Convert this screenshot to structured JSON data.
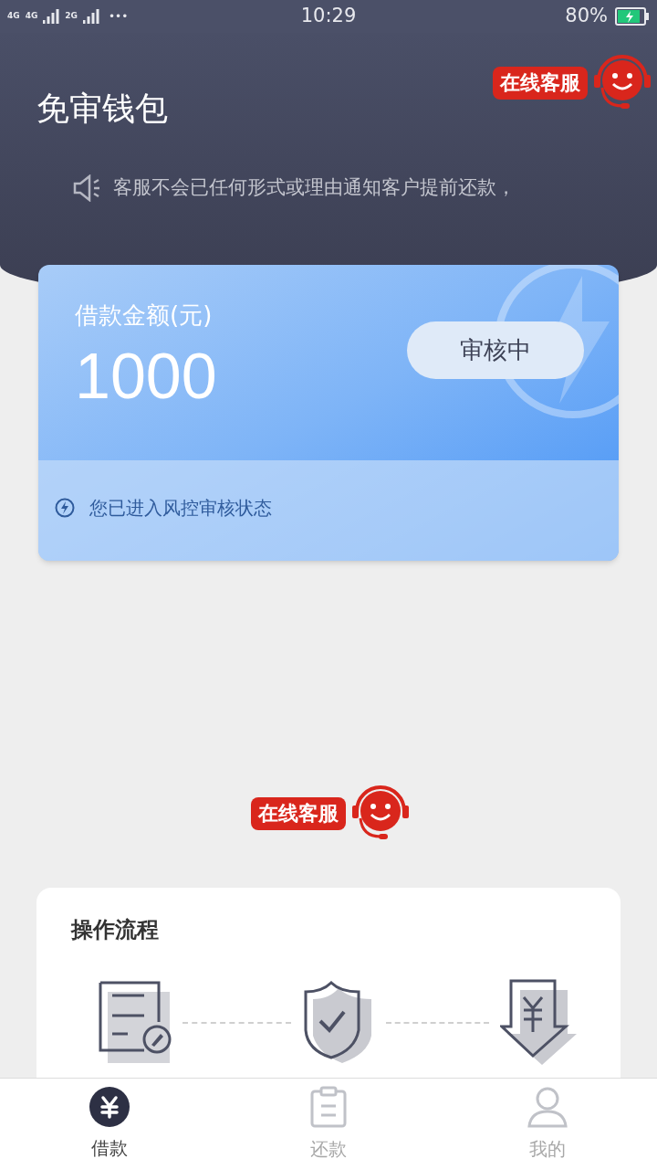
{
  "status_bar": {
    "network_1": "4G",
    "network_2": "4G",
    "network_3": "2G",
    "more": "•••",
    "time": "10:29",
    "battery": "80%"
  },
  "header": {
    "title": "免审钱包",
    "service_badge": "在线客服",
    "notice": "客服不会已任何形式或理由通知客户提前还款，"
  },
  "loan_card": {
    "label": "借款金额(元)",
    "amount": "1000",
    "status": "审核中",
    "hint": "您已进入风控审核状态"
  },
  "service_badge": "在线客服",
  "process": {
    "title": "操作流程",
    "steps": [
      {
        "kind": "form"
      },
      {
        "kind": "shield"
      },
      {
        "kind": "download"
      }
    ]
  },
  "tabs": [
    {
      "label": "借款",
      "kind": "loan",
      "selected": true
    },
    {
      "label": "还款",
      "kind": "repay",
      "selected": false
    },
    {
      "label": "我的",
      "kind": "me",
      "selected": false
    }
  ]
}
